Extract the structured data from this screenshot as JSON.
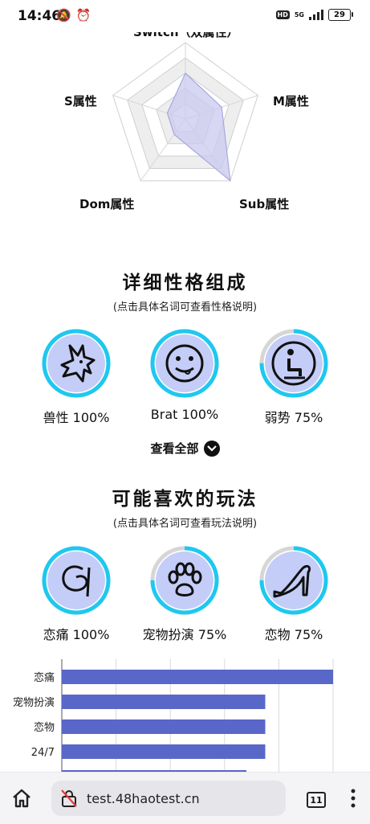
{
  "status_bar": {
    "time": "14:46",
    "network": "5G",
    "hd_badge": "HD",
    "battery": "29"
  },
  "radar": {
    "labels": {
      "top": "Switch（双属性）",
      "right": "M属性",
      "bottom_right": "Sub属性",
      "bottom_left": "Dom属性",
      "left": "S属性"
    },
    "values": {
      "top": 0.6,
      "right": 0.5,
      "bottom_right": 1.0,
      "bottom_left": 0.25,
      "left": 0.25
    },
    "fill_color": "#c9c9ef",
    "stroke_color": "#a7a7e0"
  },
  "personality": {
    "title": "详细性格组成",
    "subtitle": "(点击具体名词可查看性格说明)",
    "items": [
      {
        "label": "兽性 100%",
        "percent": 100,
        "icon": "wolf-icon"
      },
      {
        "label": "Brat 100%",
        "percent": 100,
        "icon": "smiley-icon"
      },
      {
        "label": "弱势 75%",
        "percent": 75,
        "icon": "kneeling-icon"
      }
    ],
    "view_all": "查看全部"
  },
  "play_styles": {
    "title": "可能喜欢的玩法",
    "subtitle": "(点击具体名词可查看玩法说明)",
    "items": [
      {
        "label": "恋痛 100%",
        "percent": 100,
        "icon": "whip-icon"
      },
      {
        "label": "宠物扮演 75%",
        "percent": 75,
        "icon": "paw-icon"
      },
      {
        "label": "恋物 75%",
        "percent": 75,
        "icon": "high-heel-icon"
      }
    ]
  },
  "chart_data": {
    "type": "bar",
    "orientation": "horizontal",
    "categories": [
      "恋痛",
      "宠物扮演",
      "恋物",
      "24/7"
    ],
    "values": [
      100,
      75,
      75,
      75
    ],
    "xlim": [
      0,
      100
    ],
    "bar_color": "#5867c8",
    "grid": true
  },
  "browser": {
    "url": "test.48haotest.cn",
    "tab_count": "11"
  },
  "colors": {
    "ring_accent": "#1ec8f0",
    "ring_track": "#d6d6d6",
    "icon_bg": "#c4cdf7"
  }
}
